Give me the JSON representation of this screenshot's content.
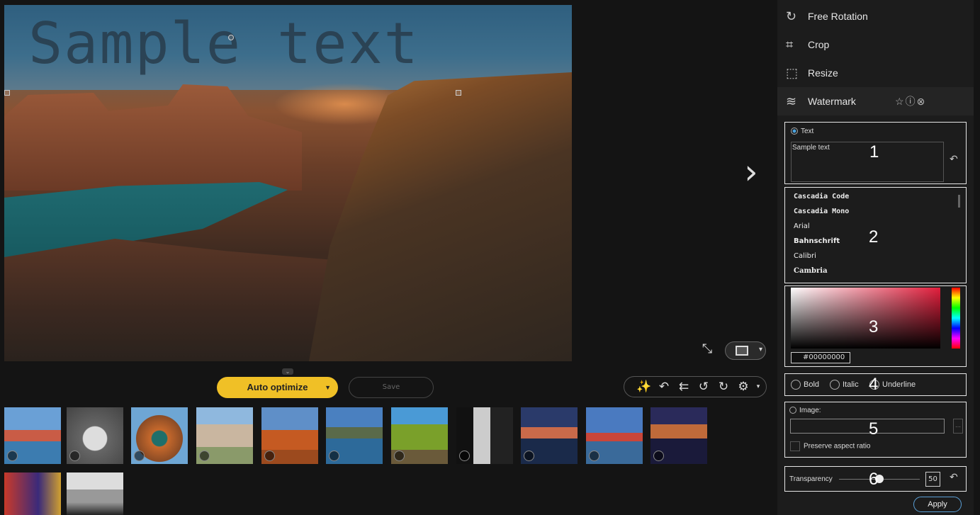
{
  "photo": {
    "watermark_text": "Sample text"
  },
  "nav": {
    "next_icon": "chevron-right-icon"
  },
  "toolbar": {
    "auto_optimize": "Auto optimize",
    "save": "Save",
    "tools": [
      "magic-wand-icon",
      "undo-icon",
      "undo-all-icon",
      "rotate-left-90-icon",
      "rotate-right-90-icon",
      "settings-icon"
    ]
  },
  "side_menu": {
    "free_rotation": "Free Rotation",
    "crop": "Crop",
    "resize": "Resize",
    "watermark": "Watermark"
  },
  "watermark": {
    "text_radio": "Text",
    "text_value": "Sample text",
    "fonts": [
      "Cascadia Code",
      "Cascadia Mono",
      "Arial",
      "Bahnschrift",
      "Calibri",
      "Cambria"
    ],
    "color_hex": "#00000000",
    "bold": "Bold",
    "italic": "Italic",
    "underline": "Underline",
    "image_radio": "Image:",
    "preserve_aspect": "Preserve aspect ratio",
    "transparency_label": "Transparency",
    "transparency_value": "50",
    "apply": "Apply"
  },
  "annotations": [
    "1",
    "2",
    "3",
    "4",
    "5",
    "6"
  ],
  "colors": {
    "accent": "#f0c026",
    "panel": "#1c1c1c",
    "background": "#141414"
  }
}
